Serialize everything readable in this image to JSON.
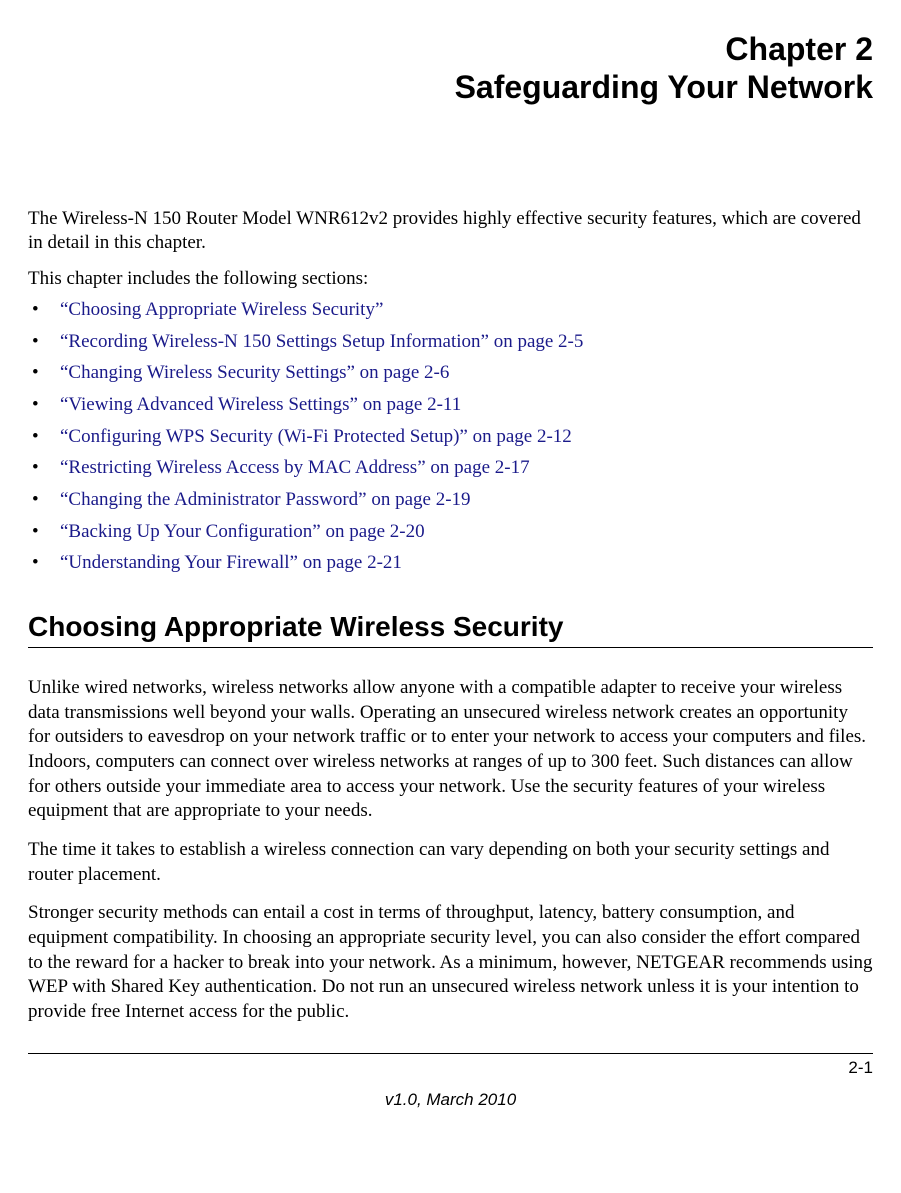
{
  "header": {
    "chapter_label": "Chapter 2",
    "chapter_title": "Safeguarding Your Network"
  },
  "intro": "The Wireless-N 150 Router Model WNR612v2 provides highly effective security features, which are covered in detail in this chapter.",
  "list_intro": "This chapter includes the following sections:",
  "sections": [
    {
      "quoted": "“Choosing Appropriate Wireless Security”",
      "suffix": ""
    },
    {
      "quoted": "“Recording Wireless-N 150 Settings Setup Information” on page 2-5",
      "suffix": ""
    },
    {
      "quoted": "“Changing Wireless Security Settings” on page 2-6",
      "suffix": ""
    },
    {
      "quoted": "“Viewing Advanced Wireless Settings” on page 2-11",
      "suffix": ""
    },
    {
      "quoted": "“Configuring WPS Security (Wi-Fi Protected Setup)” on page 2-12",
      "suffix": ""
    },
    {
      "quoted": "“Restricting Wireless Access by MAC Address” on page 2-17",
      "suffix": ""
    },
    {
      "quoted": "“Changing the Administrator Password” on page 2-19",
      "suffix": ""
    },
    {
      "quoted": "“Backing Up Your Configuration” on page 2-20",
      "suffix": ""
    },
    {
      "quoted": "“Understanding Your Firewall” on page 2-21",
      "suffix": ""
    }
  ],
  "heading1": "Choosing Appropriate Wireless Security",
  "para1": "Unlike wired networks, wireless networks allow anyone with a compatible adapter to receive your wireless data transmissions well beyond your walls. Operating an unsecured wireless network creates an opportunity for outsiders to eavesdrop on your network traffic or to enter your network to access your computers and files. Indoors, computers can connect over wireless networks at ranges of up to 300 feet. Such distances can allow for others outside your immediate area to access your network. Use the security features of your wireless equipment that are appropriate to your needs.",
  "para2": "The time it takes to establish a wireless connection can vary depending on both your security settings and router placement.",
  "para3": "Stronger security methods can entail a cost in terms of throughput, latency, battery consumption, and equipment compatibility. In choosing an appropriate security level, you can also consider the effort compared to the reward for a hacker to break into your network. As a minimum, however, NETGEAR recommends using WEP with Shared Key authentication. Do not run an unsecured wireless network unless it is your intention to provide free Internet access for the public.",
  "footer": {
    "page_number": "2-1",
    "version": "v1.0, March 2010"
  }
}
